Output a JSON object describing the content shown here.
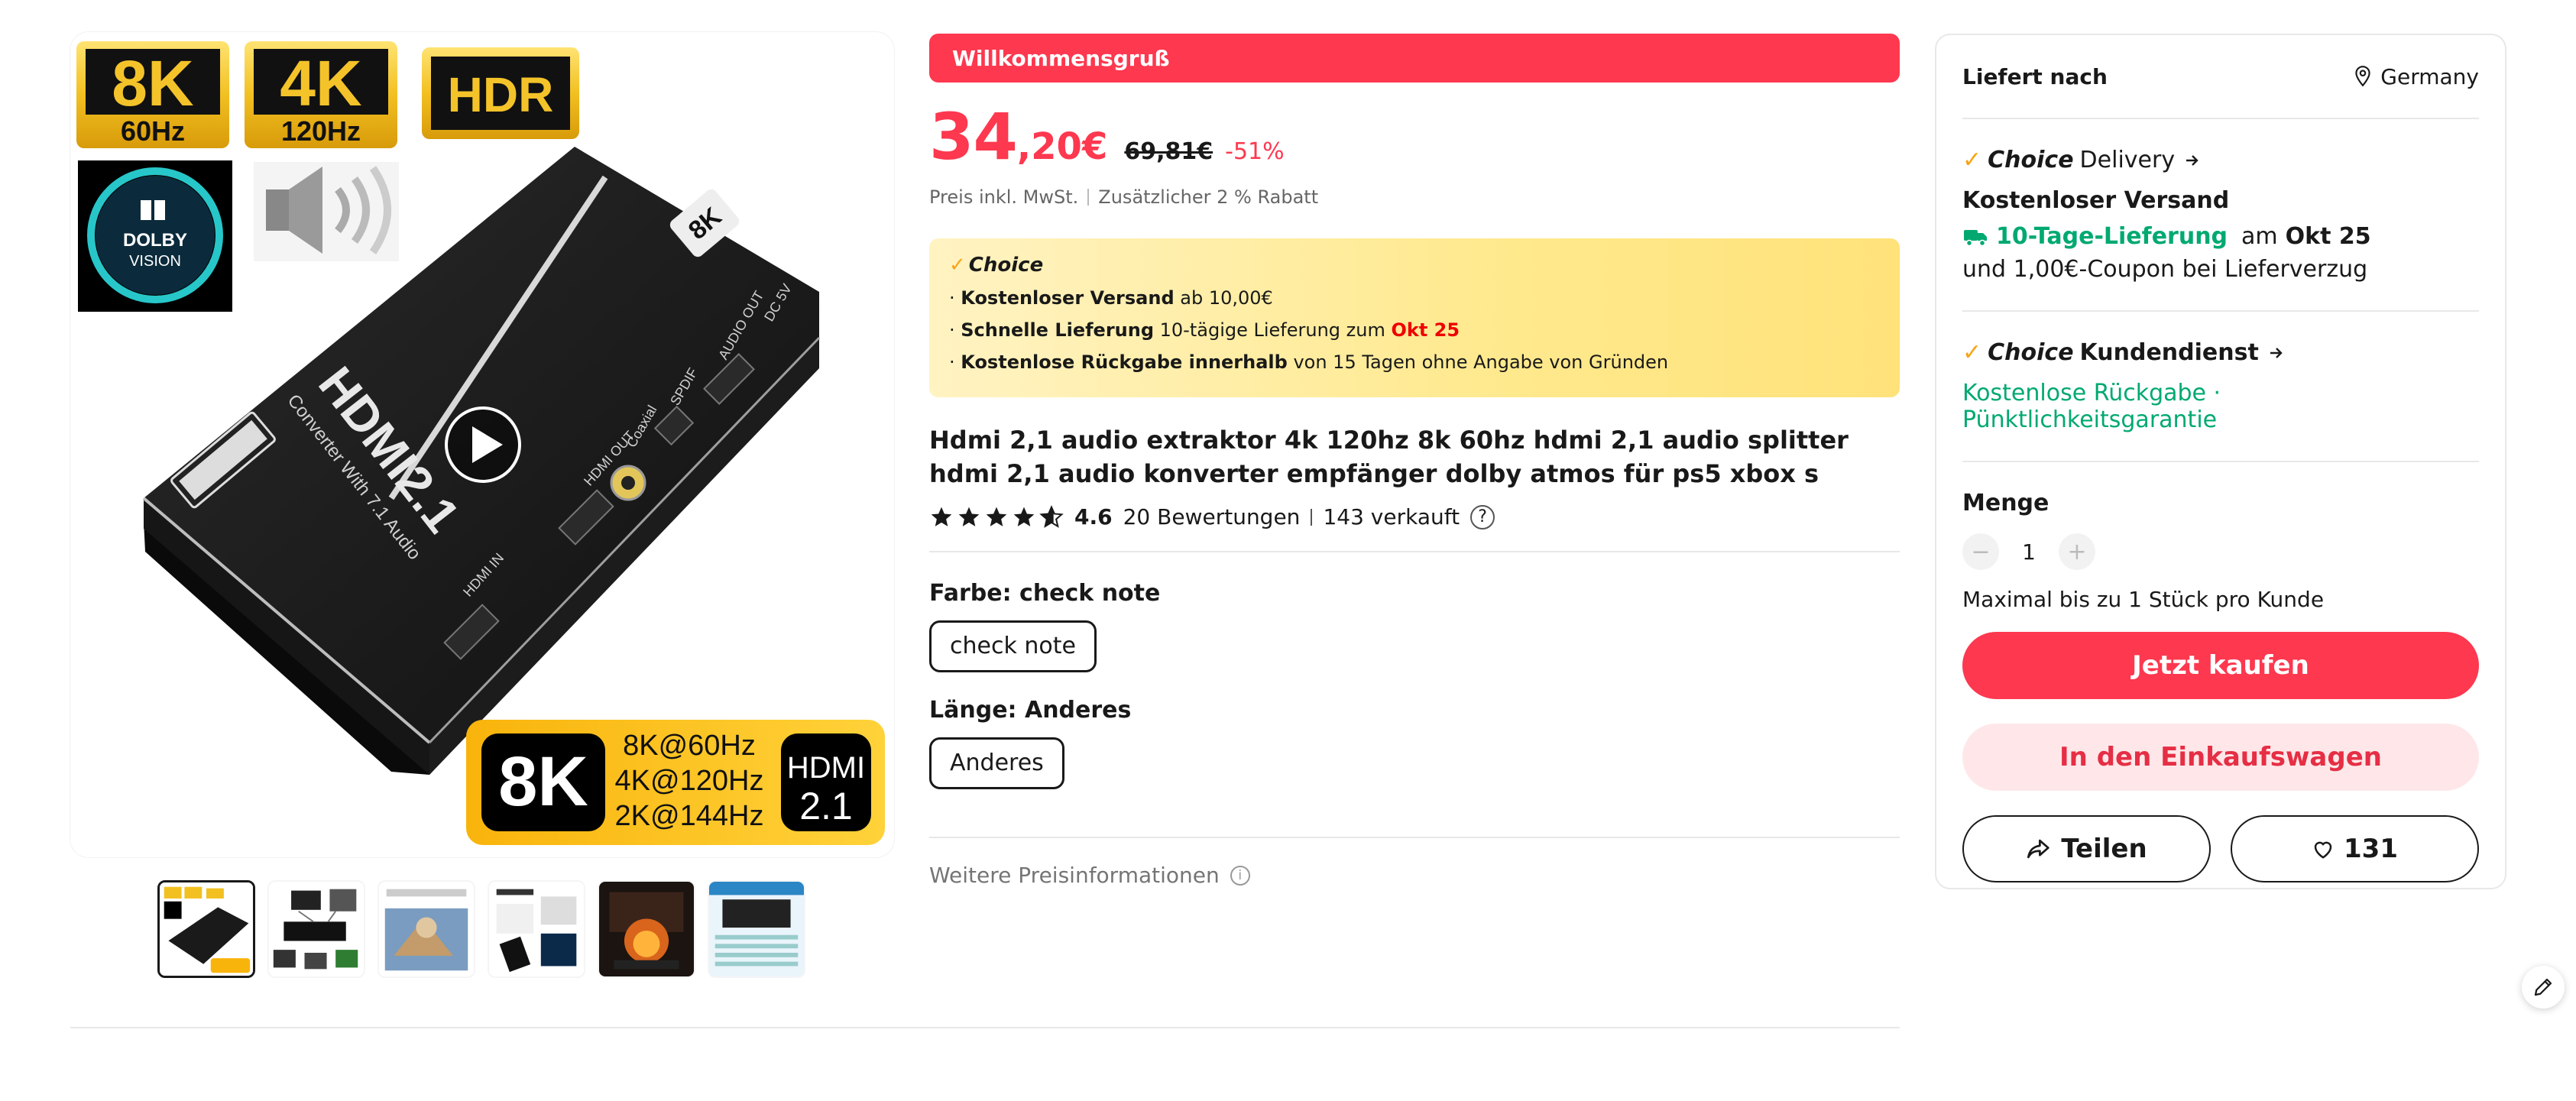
{
  "gallery": {
    "badges": {
      "b8k": "8K",
      "b8k_sub": "60Hz",
      "b4k": "4K",
      "b4k_sub": "120Hz",
      "hdr": "HDR",
      "dolby_line1": "DOLBY",
      "dolby_line2": "VISION"
    },
    "device": {
      "brand": "HDMI2.1",
      "sub": "Converter With 7.1 Audio",
      "ports": [
        "HDMI IN",
        "HDMI OUT",
        "Coaxial",
        "SPDIF",
        "AUDIO OUT",
        "DC 5V"
      ]
    },
    "banner": {
      "big": "8K",
      "lines": [
        "8K@60Hz",
        "4K@120Hz",
        "2K@144Hz"
      ],
      "hdmi_top": "HDMI",
      "hdmi_bottom": "2.1"
    }
  },
  "product": {
    "welcome": "Willkommensgruß",
    "price_int": "34",
    "price_dec": ",20€",
    "price_old": "69,81€",
    "discount": "-51%",
    "tax_note": "Preis inkl. MwSt.",
    "extra_discount": "Zusätzlicher 2 % Rabatt",
    "choice": {
      "logo": "Choice",
      "line1_bold": "Kostenloser Versand",
      "line1_rest": " ab 10,00€",
      "line2_bold": "Schnelle Lieferung",
      "line2_rest": " 10-tägige Lieferung zum ",
      "line2_date": "Okt 25",
      "line3_bold": "Kostenlose Rückgabe innerhalb",
      "line3_rest": "  von 15 Tagen ohne Angabe von Gründen"
    },
    "title": "Hdmi 2,1 audio extraktor 4k 120hz 8k 60hz hdmi 2,1 audio splitter hdmi 2,1 audio konverter empfänger dolby atmos für ps5 xbox s",
    "rating_value": 4.6,
    "rating_text": "4.6",
    "reviews": "20 Bewertungen",
    "sold": "143 verkauft",
    "color_label": "Farbe: check note",
    "color_option": "check note",
    "length_label": "Länge: Anderes",
    "length_option": "Anderes",
    "more_price_info": "Weitere Preisinformationen"
  },
  "card": {
    "ship_to_label": "Liefert nach",
    "ship_to_country": "Germany",
    "choice_word": "Choice",
    "delivery_word": "Delivery",
    "free_shipping": "Kostenloser Versand",
    "delivery_fast": "10-Tage-Lieferung",
    "delivery_at": "am",
    "delivery_date": "Okt 25",
    "coupon": "und 1,00€-Coupon bei Lieferverzug",
    "service_word": "Kundendienst",
    "free_return": "Kostenlose Rückgabe",
    "dot": " · ",
    "punctual": "Pünktlichkeitsgarantie",
    "qty_label": "Menge",
    "qty_value": "1",
    "qty_minus": "−",
    "qty_plus": "+",
    "qty_limit": "Maximal bis zu 1 Stück pro Kunde",
    "buy_now": "Jetzt kaufen",
    "add_cart": "In den Einkaufswagen",
    "share": "Teilen",
    "wishlist_count": "131"
  },
  "colors": {
    "accent": "#fd384f",
    "choice_check": "#f7a516",
    "green": "#01a971",
    "cart_bg": "#ffe7e9"
  },
  "icons": [
    "location-pin-icon",
    "arrow-right-icon",
    "truck-icon",
    "play-icon",
    "star-icon",
    "question-icon",
    "info-icon",
    "share-icon",
    "heart-icon",
    "edit-pencil-icon"
  ]
}
